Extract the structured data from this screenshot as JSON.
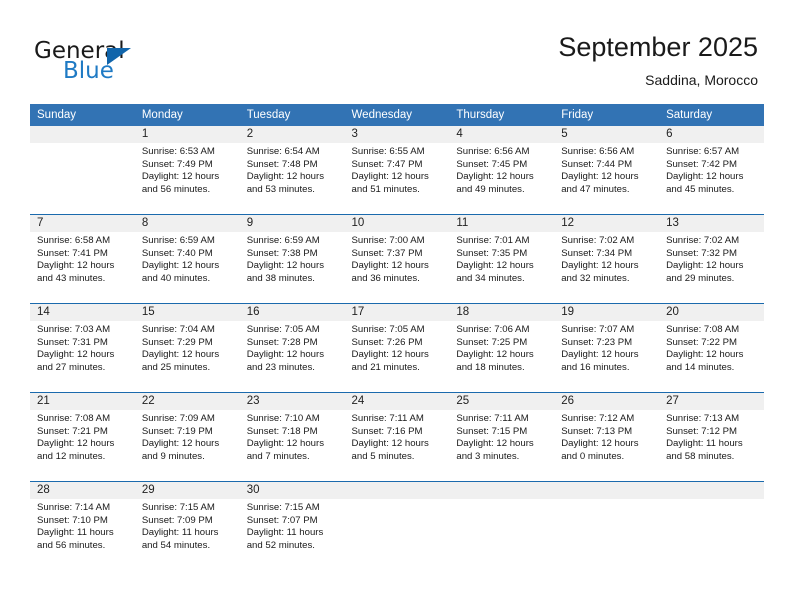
{
  "brand": {
    "name_part1": "General",
    "name_part2": "Blue",
    "accent_color": "#1f7ac4",
    "triangle_color": "#1165ab"
  },
  "header": {
    "title": "September 2025",
    "subtitle": "Saddina, Morocco"
  },
  "calendar": {
    "header_bg": "#3273b4",
    "daynum_bg": "#f0f0f0",
    "separator_color": "#1b6aad",
    "weekdays": [
      "Sunday",
      "Monday",
      "Tuesday",
      "Wednesday",
      "Thursday",
      "Friday",
      "Saturday"
    ],
    "weeks": [
      [
        {
          "day": "",
          "sunrise": "",
          "sunset": "",
          "daylight1": "",
          "daylight2": ""
        },
        {
          "day": "1",
          "sunrise": "Sunrise: 6:53 AM",
          "sunset": "Sunset: 7:49 PM",
          "daylight1": "Daylight: 12 hours",
          "daylight2": "and 56 minutes."
        },
        {
          "day": "2",
          "sunrise": "Sunrise: 6:54 AM",
          "sunset": "Sunset: 7:48 PM",
          "daylight1": "Daylight: 12 hours",
          "daylight2": "and 53 minutes."
        },
        {
          "day": "3",
          "sunrise": "Sunrise: 6:55 AM",
          "sunset": "Sunset: 7:47 PM",
          "daylight1": "Daylight: 12 hours",
          "daylight2": "and 51 minutes."
        },
        {
          "day": "4",
          "sunrise": "Sunrise: 6:56 AM",
          "sunset": "Sunset: 7:45 PM",
          "daylight1": "Daylight: 12 hours",
          "daylight2": "and 49 minutes."
        },
        {
          "day": "5",
          "sunrise": "Sunrise: 6:56 AM",
          "sunset": "Sunset: 7:44 PM",
          "daylight1": "Daylight: 12 hours",
          "daylight2": "and 47 minutes."
        },
        {
          "day": "6",
          "sunrise": "Sunrise: 6:57 AM",
          "sunset": "Sunset: 7:42 PM",
          "daylight1": "Daylight: 12 hours",
          "daylight2": "and 45 minutes."
        }
      ],
      [
        {
          "day": "7",
          "sunrise": "Sunrise: 6:58 AM",
          "sunset": "Sunset: 7:41 PM",
          "daylight1": "Daylight: 12 hours",
          "daylight2": "and 43 minutes."
        },
        {
          "day": "8",
          "sunrise": "Sunrise: 6:59 AM",
          "sunset": "Sunset: 7:40 PM",
          "daylight1": "Daylight: 12 hours",
          "daylight2": "and 40 minutes."
        },
        {
          "day": "9",
          "sunrise": "Sunrise: 6:59 AM",
          "sunset": "Sunset: 7:38 PM",
          "daylight1": "Daylight: 12 hours",
          "daylight2": "and 38 minutes."
        },
        {
          "day": "10",
          "sunrise": "Sunrise: 7:00 AM",
          "sunset": "Sunset: 7:37 PM",
          "daylight1": "Daylight: 12 hours",
          "daylight2": "and 36 minutes."
        },
        {
          "day": "11",
          "sunrise": "Sunrise: 7:01 AM",
          "sunset": "Sunset: 7:35 PM",
          "daylight1": "Daylight: 12 hours",
          "daylight2": "and 34 minutes."
        },
        {
          "day": "12",
          "sunrise": "Sunrise: 7:02 AM",
          "sunset": "Sunset: 7:34 PM",
          "daylight1": "Daylight: 12 hours",
          "daylight2": "and 32 minutes."
        },
        {
          "day": "13",
          "sunrise": "Sunrise: 7:02 AM",
          "sunset": "Sunset: 7:32 PM",
          "daylight1": "Daylight: 12 hours",
          "daylight2": "and 29 minutes."
        }
      ],
      [
        {
          "day": "14",
          "sunrise": "Sunrise: 7:03 AM",
          "sunset": "Sunset: 7:31 PM",
          "daylight1": "Daylight: 12 hours",
          "daylight2": "and 27 minutes."
        },
        {
          "day": "15",
          "sunrise": "Sunrise: 7:04 AM",
          "sunset": "Sunset: 7:29 PM",
          "daylight1": "Daylight: 12 hours",
          "daylight2": "and 25 minutes."
        },
        {
          "day": "16",
          "sunrise": "Sunrise: 7:05 AM",
          "sunset": "Sunset: 7:28 PM",
          "daylight1": "Daylight: 12 hours",
          "daylight2": "and 23 minutes."
        },
        {
          "day": "17",
          "sunrise": "Sunrise: 7:05 AM",
          "sunset": "Sunset: 7:26 PM",
          "daylight1": "Daylight: 12 hours",
          "daylight2": "and 21 minutes."
        },
        {
          "day": "18",
          "sunrise": "Sunrise: 7:06 AM",
          "sunset": "Sunset: 7:25 PM",
          "daylight1": "Daylight: 12 hours",
          "daylight2": "and 18 minutes."
        },
        {
          "day": "19",
          "sunrise": "Sunrise: 7:07 AM",
          "sunset": "Sunset: 7:23 PM",
          "daylight1": "Daylight: 12 hours",
          "daylight2": "and 16 minutes."
        },
        {
          "day": "20",
          "sunrise": "Sunrise: 7:08 AM",
          "sunset": "Sunset: 7:22 PM",
          "daylight1": "Daylight: 12 hours",
          "daylight2": "and 14 minutes."
        }
      ],
      [
        {
          "day": "21",
          "sunrise": "Sunrise: 7:08 AM",
          "sunset": "Sunset: 7:21 PM",
          "daylight1": "Daylight: 12 hours",
          "daylight2": "and 12 minutes."
        },
        {
          "day": "22",
          "sunrise": "Sunrise: 7:09 AM",
          "sunset": "Sunset: 7:19 PM",
          "daylight1": "Daylight: 12 hours",
          "daylight2": "and 9 minutes."
        },
        {
          "day": "23",
          "sunrise": "Sunrise: 7:10 AM",
          "sunset": "Sunset: 7:18 PM",
          "daylight1": "Daylight: 12 hours",
          "daylight2": "and 7 minutes."
        },
        {
          "day": "24",
          "sunrise": "Sunrise: 7:11 AM",
          "sunset": "Sunset: 7:16 PM",
          "daylight1": "Daylight: 12 hours",
          "daylight2": "and 5 minutes."
        },
        {
          "day": "25",
          "sunrise": "Sunrise: 7:11 AM",
          "sunset": "Sunset: 7:15 PM",
          "daylight1": "Daylight: 12 hours",
          "daylight2": "and 3 minutes."
        },
        {
          "day": "26",
          "sunrise": "Sunrise: 7:12 AM",
          "sunset": "Sunset: 7:13 PM",
          "daylight1": "Daylight: 12 hours",
          "daylight2": "and 0 minutes."
        },
        {
          "day": "27",
          "sunrise": "Sunrise: 7:13 AM",
          "sunset": "Sunset: 7:12 PM",
          "daylight1": "Daylight: 11 hours",
          "daylight2": "and 58 minutes."
        }
      ],
      [
        {
          "day": "28",
          "sunrise": "Sunrise: 7:14 AM",
          "sunset": "Sunset: 7:10 PM",
          "daylight1": "Daylight: 11 hours",
          "daylight2": "and 56 minutes."
        },
        {
          "day": "29",
          "sunrise": "Sunrise: 7:15 AM",
          "sunset": "Sunset: 7:09 PM",
          "daylight1": "Daylight: 11 hours",
          "daylight2": "and 54 minutes."
        },
        {
          "day": "30",
          "sunrise": "Sunrise: 7:15 AM",
          "sunset": "Sunset: 7:07 PM",
          "daylight1": "Daylight: 11 hours",
          "daylight2": "and 52 minutes."
        },
        {
          "day": "",
          "sunrise": "",
          "sunset": "",
          "daylight1": "",
          "daylight2": ""
        },
        {
          "day": "",
          "sunrise": "",
          "sunset": "",
          "daylight1": "",
          "daylight2": ""
        },
        {
          "day": "",
          "sunrise": "",
          "sunset": "",
          "daylight1": "",
          "daylight2": ""
        },
        {
          "day": "",
          "sunrise": "",
          "sunset": "",
          "daylight1": "",
          "daylight2": ""
        }
      ]
    ]
  }
}
